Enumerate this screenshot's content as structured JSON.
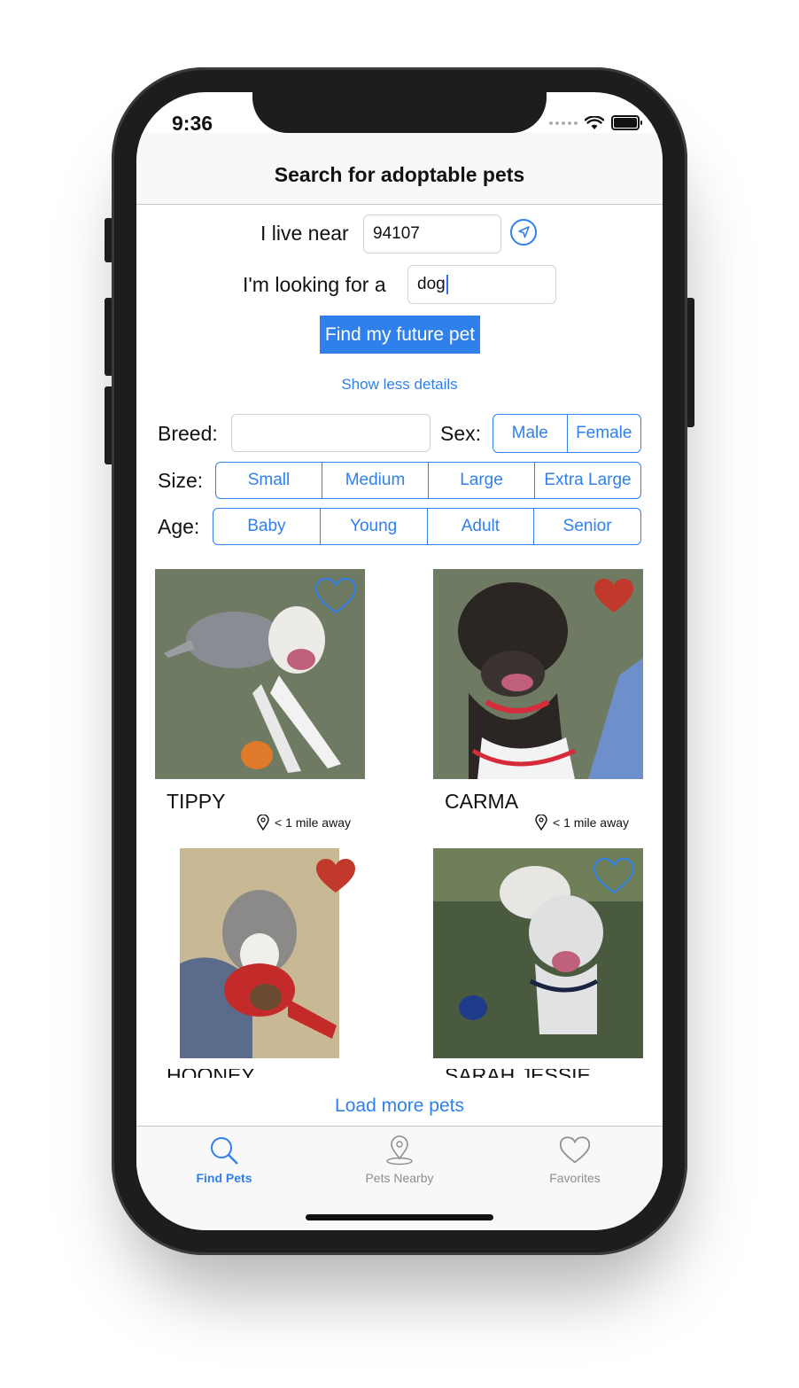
{
  "status_bar": {
    "time": "9:36"
  },
  "header": {
    "title": "Search for adoptable pets"
  },
  "search": {
    "location_label": "I live near",
    "location_value": "94107",
    "animal_label": "I'm looking for a",
    "animal_value": "dog",
    "find_button": "Find my future pet",
    "details_toggle": "Show less details"
  },
  "filters": {
    "breed_label": "Breed:",
    "breed_value": "",
    "sex_label": "Sex:",
    "sex_options": [
      "Male",
      "Female"
    ],
    "size_label": "Size:",
    "size_options": [
      "Small",
      "Medium",
      "Large",
      "Extra Large"
    ],
    "age_label": "Age:",
    "age_options": [
      "Baby",
      "Young",
      "Adult",
      "Senior"
    ]
  },
  "pets": [
    {
      "name": "TIPPY",
      "distance": "< 1 mile away",
      "favorited": false
    },
    {
      "name": "CARMA",
      "distance": "< 1 mile away",
      "favorited": true
    },
    {
      "name": "HOONEY",
      "distance": "",
      "favorited": true
    },
    {
      "name": "SARAH JESSIE",
      "distance": "",
      "favorited": false
    }
  ],
  "load_more": "Load more pets",
  "tabs": [
    {
      "label": "Find Pets",
      "icon": "magnifier-icon",
      "active": true
    },
    {
      "label": "Pets Nearby",
      "icon": "map-pin-icon",
      "active": false
    },
    {
      "label": "Favorites",
      "icon": "heart-icon",
      "active": false
    }
  ],
  "colors": {
    "accent": "#2f80ed",
    "heart": "#c0392b",
    "inactive": "#8e8e93"
  }
}
